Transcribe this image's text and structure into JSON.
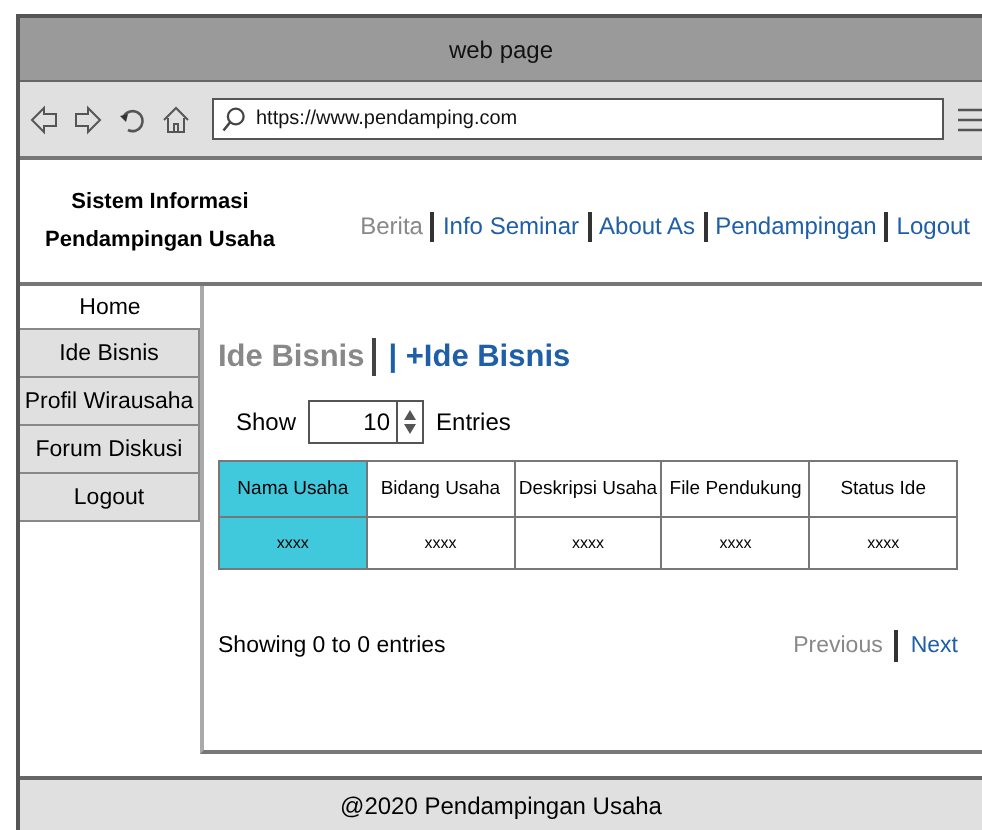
{
  "window": {
    "title": "web page"
  },
  "address_bar": {
    "value": "https://www.pendamping.com"
  },
  "header": {
    "title_lines": [
      "Sistem Informasi",
      "Pendampingan Usaha"
    ]
  },
  "nav": [
    {
      "label": "Berita",
      "current": true
    },
    {
      "label": "Info Seminar",
      "current": false
    },
    {
      "label": "About As",
      "current": false
    },
    {
      "label": "Pendampingan",
      "current": false
    },
    {
      "label": "Logout",
      "current": false
    }
  ],
  "sidebar": {
    "items": [
      {
        "label": "Home",
        "selected": true
      },
      {
        "label": "Ide Bisnis",
        "selected": false
      },
      {
        "label": "Profil Wirausaha",
        "selected": false
      },
      {
        "label": "Forum Diskusi",
        "selected": false
      },
      {
        "label": "Logout",
        "selected": false
      }
    ]
  },
  "main": {
    "heading": "Ide Bisnis",
    "add_link": "| +Ide Bisnis",
    "show_label": "Show",
    "page_size": "10",
    "entries_label": "Entries",
    "table": {
      "columns": [
        {
          "label": "Nama Usaha",
          "highlighted": true
        },
        {
          "label": "Bidang Usaha",
          "highlighted": false
        },
        {
          "label": "Deskripsi Usaha",
          "highlighted": false
        },
        {
          "label": "File Pendukung",
          "highlighted": false
        },
        {
          "label": "Status Ide",
          "highlighted": false
        }
      ],
      "rows": [
        [
          "xxxx",
          "xxxx",
          "xxxx",
          "xxxx",
          "xxxx"
        ]
      ]
    },
    "info": "Showing 0 to 0 entries",
    "pagination": [
      {
        "label": "Previous",
        "disabled": true
      },
      {
        "label": "Next",
        "disabled": false
      }
    ]
  },
  "footer": {
    "text": "@2020 Pendampingan Usaha"
  }
}
